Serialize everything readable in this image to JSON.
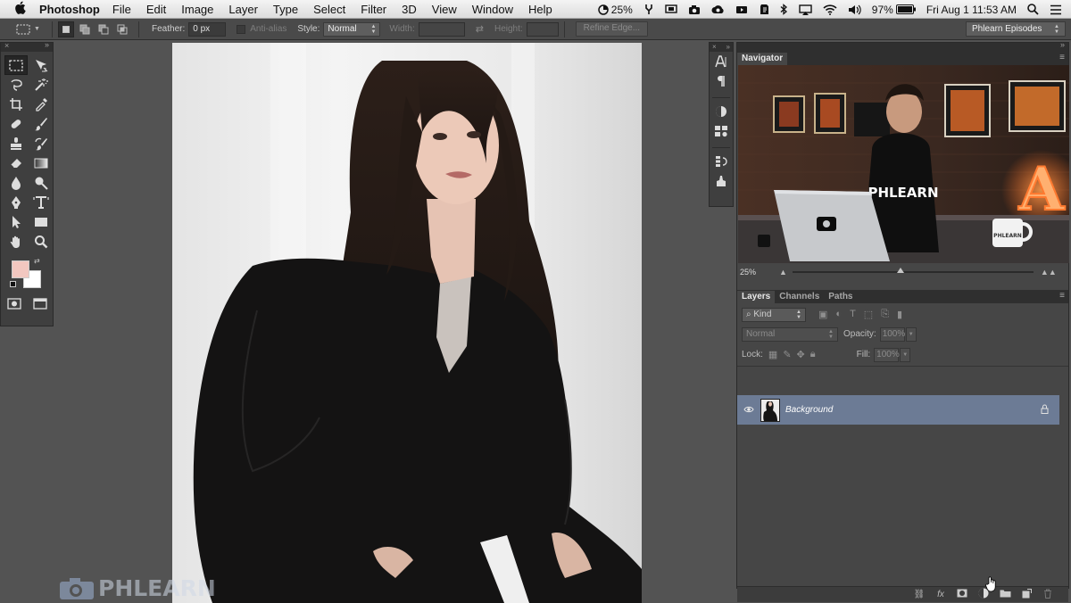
{
  "menubar": {
    "app_name": "Photoshop",
    "items": [
      "File",
      "Edit",
      "Image",
      "Layer",
      "Type",
      "Select",
      "Filter",
      "3D",
      "View",
      "Window",
      "Help"
    ],
    "status": {
      "cpu_percent": "25%",
      "battery_percent": "97%",
      "datetime": "Fri Aug 1  11:53 AM"
    }
  },
  "optionsbar": {
    "feather_label": "Feather:",
    "feather_value": "0 px",
    "antialias_label": "Anti-alias",
    "style_label": "Style:",
    "style_value": "Normal",
    "width_label": "Width:",
    "height_label": "Height:",
    "refine_label": "Refine Edge...",
    "workspace_value": "Phlearn Episodes"
  },
  "watermark": {
    "text": "PHLEARN"
  },
  "navigator": {
    "tab_label": "Navigator",
    "zoom_value": "25%",
    "zoom_level": 0.45,
    "thumb_text": {
      "shirt_text": "PHLEARN",
      "mug_text": "PHLEARN",
      "sign_letter": "A"
    }
  },
  "layers": {
    "tabs": [
      "Layers",
      "Channels",
      "Paths"
    ],
    "filter_kind": "Kind",
    "blend_mode": "Normal",
    "opacity_label": "Opacity:",
    "opacity_value": "100%",
    "lock_label": "Lock:",
    "fill_label": "Fill:",
    "fill_value": "100%",
    "items": [
      {
        "name": "Background",
        "visible": true,
        "locked": true
      }
    ]
  },
  "colors": {
    "foreground": "#f2c7c0",
    "background": "#ffffff",
    "selected_layer": "#6c7b95",
    "panel_bg": "#464646"
  }
}
